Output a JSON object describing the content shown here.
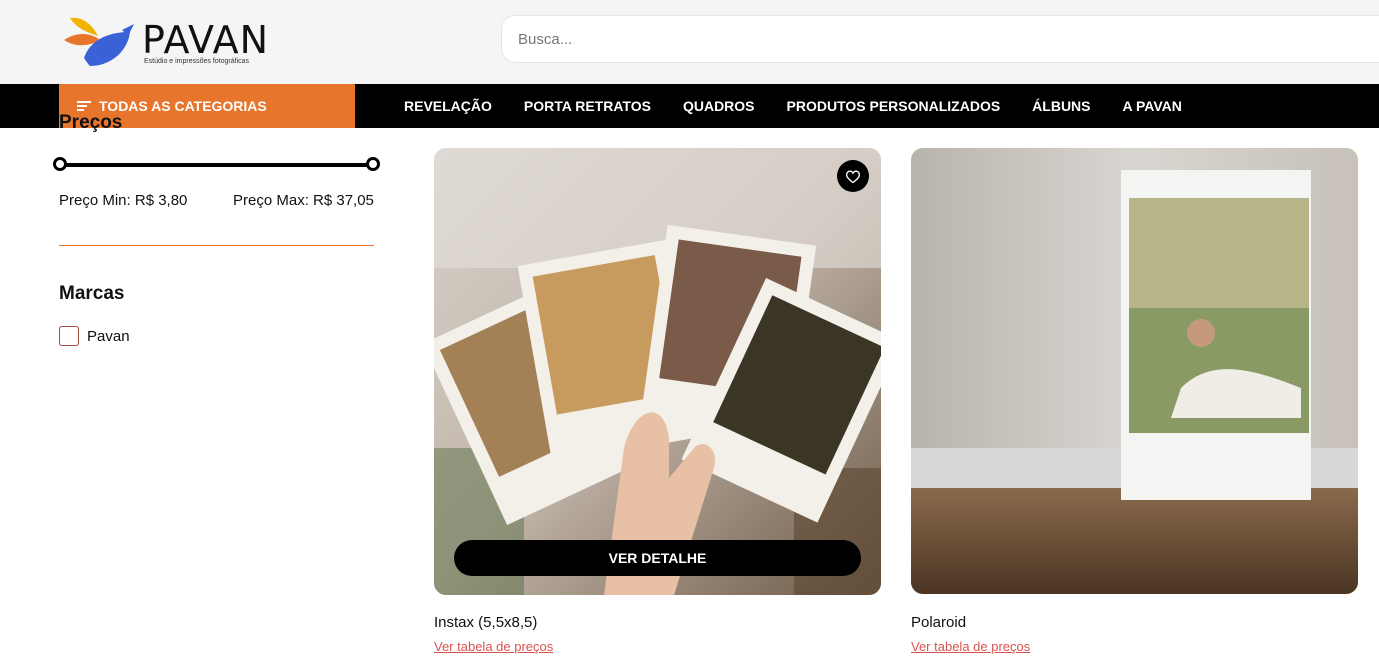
{
  "header": {
    "brand": "PAVAN",
    "tagline": "Estúdio e impressões fotográficas",
    "search_placeholder": "Busca..."
  },
  "nav": {
    "categories_label": "TODAS AS CATEGORIAS",
    "items": [
      "REVELAÇÃO",
      "PORTA RETRATOS",
      "QUADROS",
      "PRODUTOS PERSONALIZADOS",
      "ÁLBUNS",
      "A PAVAN"
    ]
  },
  "filters": {
    "price_heading": "Preços",
    "price_min": "Preço Min: R$ 3,80",
    "price_max": "Preço Max: R$ 37,05",
    "brands_heading": "Marcas",
    "brands": [
      "Pavan"
    ]
  },
  "products": [
    {
      "title": "Instax (5,5x8,5)",
      "link": "Ver tabela de preços",
      "button": "VER DETALHE",
      "icon": "heart-icon"
    },
    {
      "title": "Polaroid",
      "link": "Ver tabela de preços"
    }
  ],
  "colors": {
    "accent": "#e8752c",
    "nav_bg": "#000000",
    "link": "#d9534f"
  }
}
